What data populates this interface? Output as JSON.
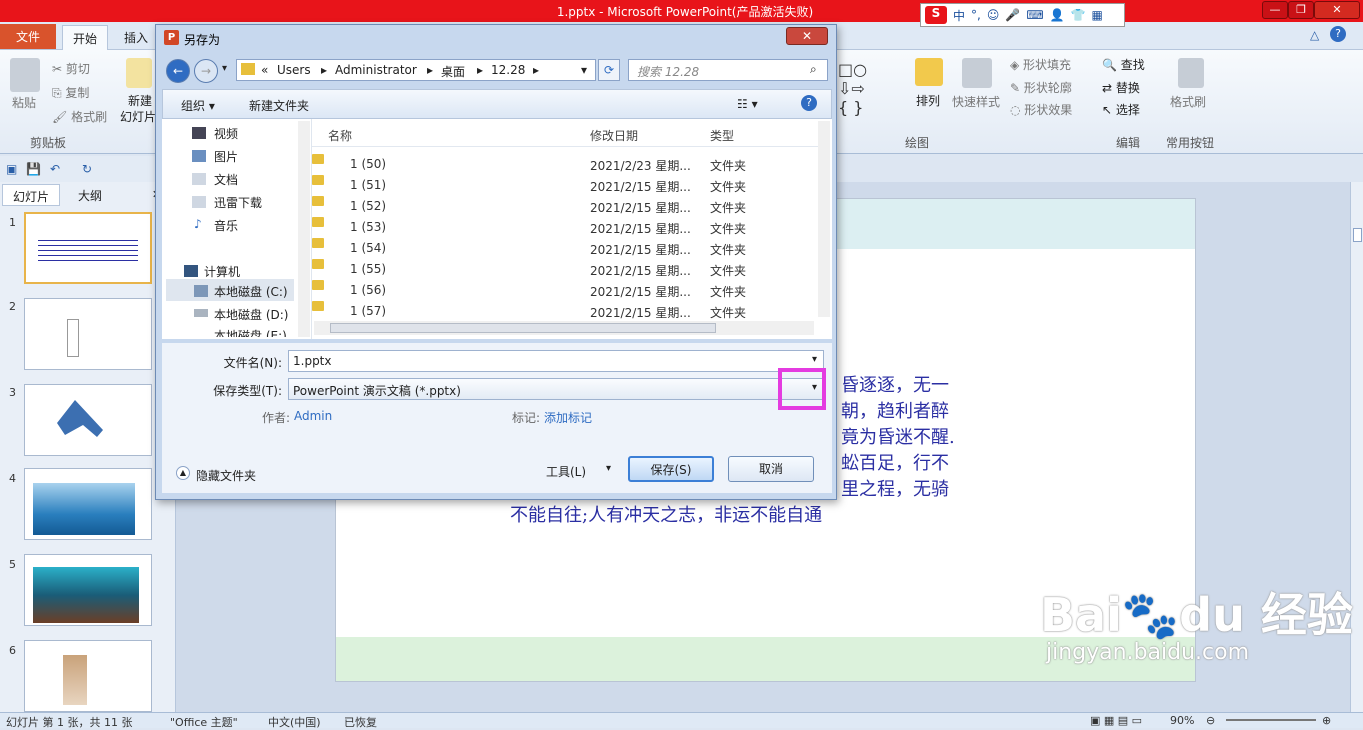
{
  "app": {
    "window_title": "1.pptx - Microsoft PowerPoint(产品激活失败)",
    "ime_logo": "S",
    "ime_label": "中"
  },
  "ribbon": {
    "tabs": [
      "文件",
      "开始",
      "插入"
    ],
    "clipboard": {
      "paste": "粘贴",
      "cut": "剪切",
      "copy": "复制",
      "format_painter": "格式刷",
      "group": "剪贴板"
    },
    "slides": {
      "new_slide_line1": "新建",
      "new_slide_line2": "幻灯片"
    },
    "drawing": {
      "arrange": "排列",
      "quick_styles": "快速样式",
      "shape_fill": "形状填充",
      "shape_outline": "形状轮廓",
      "shape_effects": "形状效果",
      "group": "绘图"
    },
    "editing": {
      "find": "查找",
      "replace": "替换",
      "select": "选择",
      "group": "编辑"
    },
    "common": {
      "format_painter": "格式刷",
      "group": "常用按钮"
    }
  },
  "left_panel": {
    "tabs": [
      "幻灯片",
      "大纲"
    ],
    "slide_numbers": [
      "1",
      "2",
      "3",
      "4",
      "5",
      "6"
    ]
  },
  "slide": {
    "text_lines": [
      "昏逐逐，无一",
      "朝，趋利者醉",
      "竟为昏迷不醒.",
      "蚣百足，行不",
      "里之程，无骑",
      "不能自往;人有冲天之志，非运不能自通"
    ]
  },
  "status": {
    "slide_info": "幻灯片 第 1 张，共 11 张",
    "theme": "\"Office 主题\"",
    "language": "中文(中国)",
    "recovered": "已恢复",
    "zoom": "90%"
  },
  "dialog": {
    "title": "另存为",
    "close": "✕",
    "breadcrumb": [
      "«",
      "Users",
      "Administrator",
      "桌面",
      "12.28"
    ],
    "search_placeholder": "搜索 12.28",
    "organize": "组织 ▾",
    "new_folder": "新建文件夹",
    "nav_items": [
      "视频",
      "图片",
      "文档",
      "迅雷下载",
      "音乐",
      "计算机",
      "本地磁盘 (C:)",
      "本地磁盘 (D:)",
      "本地磁盘 (E:)"
    ],
    "columns": {
      "name": "名称",
      "date": "修改日期",
      "type": "类型"
    },
    "files": [
      {
        "name": "1 (50)",
        "date": "2021/2/23 星期...",
        "type": "文件夹"
      },
      {
        "name": "1 (51)",
        "date": "2021/2/15 星期...",
        "type": "文件夹"
      },
      {
        "name": "1 (52)",
        "date": "2021/2/15 星期...",
        "type": "文件夹"
      },
      {
        "name": "1 (53)",
        "date": "2021/2/15 星期...",
        "type": "文件夹"
      },
      {
        "name": "1 (54)",
        "date": "2021/2/15 星期...",
        "type": "文件夹"
      },
      {
        "name": "1 (55)",
        "date": "2021/2/15 星期...",
        "type": "文件夹"
      },
      {
        "name": "1 (56)",
        "date": "2021/2/15 星期...",
        "type": "文件夹"
      },
      {
        "name": "1 (57)",
        "date": "2021/2/15 星期...",
        "type": "文件夹"
      }
    ],
    "filename_label": "文件名(N):",
    "filename_value": "1.pptx",
    "filetype_label": "保存类型(T):",
    "filetype_value": "PowerPoint 演示文稿 (*.pptx)",
    "author_label": "作者:",
    "author_value": "Admin",
    "tags_label": "标记:",
    "tags_value": "添加标记",
    "hide_folders": "隐藏文件夹",
    "tools": "工具(L)",
    "save": "保存(S)",
    "cancel": "取消"
  },
  "watermark": {
    "brand": "Bai",
    "brand2": "du",
    "cn": "经验",
    "url": "jingyan.baidu.com"
  }
}
